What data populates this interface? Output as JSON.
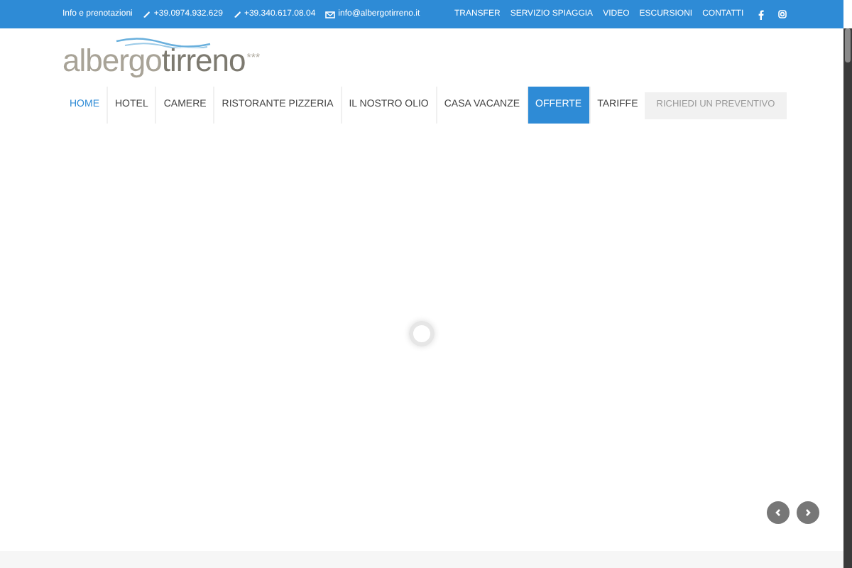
{
  "top_bar": {
    "info": "Info e prenotazioni",
    "phone_1": "+39.0974.932.629",
    "phone_2": "+39.340.617.08.04",
    "email": "info@albergotirreno.it",
    "links": [
      "TRANSFER",
      "SERVIZIO SPIAGGIA",
      "VIDEO",
      "ESCURSIONI",
      "CONTATTI"
    ]
  },
  "logo": {
    "part_1": "albergo",
    "part_2": "tirreno",
    "stars": "***"
  },
  "nav": [
    {
      "label": "HOME",
      "selected": true,
      "highlighted": false
    },
    {
      "label": "HOTEL",
      "selected": false,
      "highlighted": false
    },
    {
      "label": "CAMERE",
      "selected": false,
      "highlighted": false
    },
    {
      "label": "RISTORANTE PIZZERIA",
      "selected": false,
      "highlighted": false
    },
    {
      "label": "IL NOSTRO OLIO",
      "selected": false,
      "highlighted": false
    },
    {
      "label": "CASA VACANZE",
      "selected": false,
      "highlighted": false
    },
    {
      "label": "OFFERTE",
      "selected": false,
      "highlighted": true
    },
    {
      "label": "TARIFFE",
      "selected": false,
      "highlighted": false
    }
  ],
  "quote_button": "RICHIEDI UN PREVENTIVO"
}
